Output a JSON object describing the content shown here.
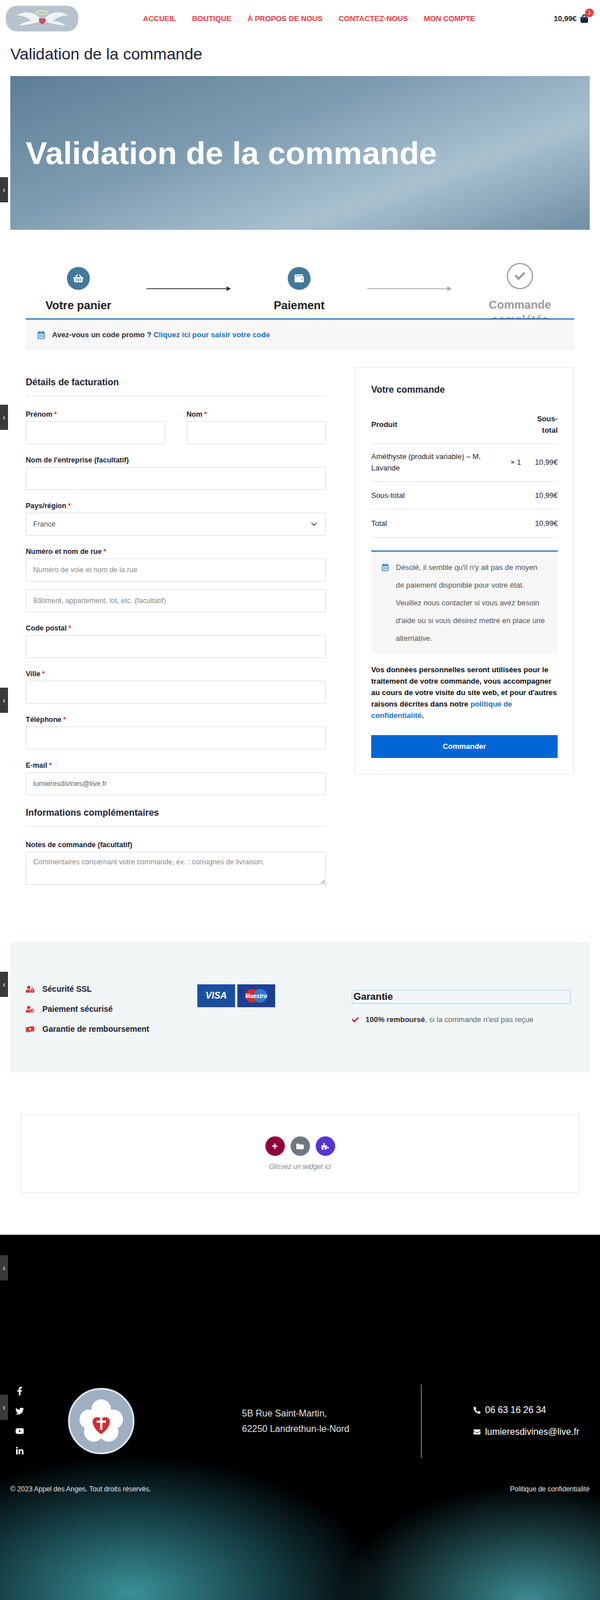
{
  "header": {
    "nav": [
      {
        "label": "ACCUEIL"
      },
      {
        "label": "BOUTIQUE"
      },
      {
        "label": "À PROPOS DE NOUS"
      },
      {
        "label": "CONTACTEZ-NOUS"
      },
      {
        "label": "MON COMPTE"
      }
    ],
    "cart": {
      "total": "10,99€",
      "count": "1"
    }
  },
  "side_toggles": [
    "‹",
    "‹",
    "‹",
    "‹",
    "‹",
    "‹"
  ],
  "page_title": "Validation de la commande",
  "hero": {
    "title": "Validation de la commande"
  },
  "steps": [
    {
      "label": "Votre panier",
      "completed": true
    },
    {
      "label": "Paiement",
      "completed": true
    },
    {
      "label": "Commande complétée",
      "completed": false
    }
  ],
  "coupon": {
    "question": "Avez-vous un code promo ?",
    "link": "Cliquez ici pour saisir votre code"
  },
  "billing": {
    "title": "Détails de facturation",
    "required_mark": "*",
    "rows": [
      [
        {
          "label": "Prénom",
          "required": true,
          "kind": "text",
          "value": "",
          "inputs": [
            {
              "placeholder": "",
              "value": ""
            }
          ]
        },
        {
          "label": "Nom",
          "required": true,
          "kind": "text",
          "value": "",
          "inputs": [
            {
              "placeholder": "",
              "value": ""
            }
          ]
        }
      ],
      [
        {
          "label": "Nom de l'entreprise (facultatif)",
          "required": false,
          "kind": "text",
          "value": "",
          "inputs": [
            {
              "placeholder": "",
              "value": ""
            }
          ]
        }
      ],
      [
        {
          "label": "Pays/région",
          "required": true,
          "kind": "select",
          "value": "France",
          "inputs": []
        }
      ],
      [
        {
          "label": "Numéro et nom de rue",
          "required": true,
          "kind": "text",
          "value": "",
          "inputs": [
            {
              "placeholder": "Numéro de voie et nom de la rue",
              "value": ""
            },
            {
              "placeholder": "Bâtiment, appartement, lot, etc. (facultatif)",
              "value": ""
            }
          ]
        }
      ],
      [
        {
          "label": "Code postal",
          "required": true,
          "kind": "text",
          "value": "",
          "inputs": [
            {
              "placeholder": "",
              "value": ""
            }
          ]
        }
      ],
      [
        {
          "label": "Ville",
          "required": true,
          "kind": "text",
          "value": "",
          "inputs": [
            {
              "placeholder": "",
              "value": ""
            }
          ]
        }
      ],
      [
        {
          "label": "Téléphone",
          "required": true,
          "kind": "text",
          "value": "",
          "inputs": [
            {
              "placeholder": "",
              "value": ""
            }
          ]
        }
      ],
      [
        {
          "label": "E-mail",
          "required": true,
          "kind": "text",
          "value": "",
          "inputs": [
            {
              "placeholder": "",
              "value": "lumieresdivines@live.fr"
            }
          ]
        }
      ]
    ]
  },
  "additional": {
    "title": "Informations complémentaires",
    "field": {
      "label": "Notes de commande (facultatif)",
      "required": false,
      "kind": "textarea",
      "value": "",
      "inputs": [
        {
          "placeholder": "Commentaires concernant votre commande, ex. : consignes de livraison.",
          "value": ""
        }
      ]
    }
  },
  "order": {
    "title": "Votre commande",
    "columns": [
      "Produit",
      "Sous-total"
    ],
    "items": [
      {
        "name": "Améthyste (produit variable) – M, Lavande",
        "qty": "× 1",
        "price": "10,99€"
      }
    ],
    "subtotal": {
      "label": "Sous-total",
      "value": "10,99€"
    },
    "total": {
      "label": "Total",
      "value": "10,99€"
    },
    "notice": "Désolé, il semble qu'il n'y ait pas de moyen de paiement disponible pour votre état. Veuillez nous contacter si vous avez besoin d'aide ou si vous désirez mettre en place une alternative.",
    "privacy": {
      "text": "Vos données personnelles seront utilisées pour le traitement de votre commande, vous accompagner au cours de votre visite du site web, et pour d'autres raisons décrites dans notre ",
      "link": "politique de confidentialité",
      "end": "."
    },
    "button": "Commander"
  },
  "trust": {
    "items": [
      "Sécurité SSL",
      "Paiement sécurisé",
      "Garantie de remboursement"
    ],
    "cards": [
      "VISA",
      "Maestro"
    ],
    "guarantee": {
      "title": "Garantie",
      "strong": "100% remboursé",
      "rest": ", si la commande n'est pas reçue"
    }
  },
  "widget_area": {
    "add": "+",
    "hint": "Glissez un widget ici"
  },
  "footer": {
    "address": [
      "5B Rue Saint-Martin,",
      "62250 Landrethun-le-Nord"
    ],
    "phone": "06 63 16 26 34",
    "email": "lumieresdivines@live.fr",
    "copyright": "© 2023 Appel des Anges. Tout droits réservés.",
    "privacy": "Politique de confidentialité"
  }
}
